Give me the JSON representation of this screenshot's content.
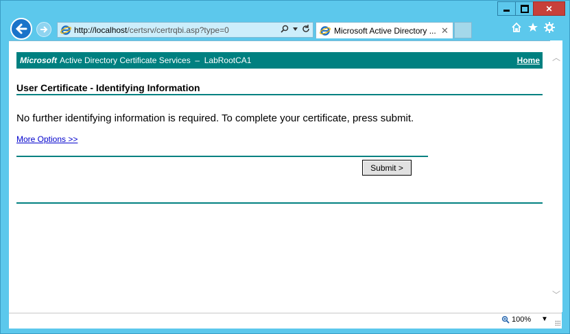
{
  "browser": {
    "address": {
      "host": "http://localhost",
      "path": "/certsrv/certrqbi.asp?type=0"
    },
    "tab": {
      "title": "Microsoft Active Directory ...",
      "close": "✕"
    },
    "window_controls": {
      "close": "✕"
    },
    "icons": [
      "back-arrow-icon",
      "forward-arrow-icon",
      "ie-logo-icon",
      "search-icon",
      "refresh-icon",
      "home-icon",
      "favorites-star-icon",
      "settings-gear-icon"
    ]
  },
  "page": {
    "banner": {
      "brand": "Microsoft",
      "title": "Active Directory Certificate Services  –  LabRootCA1",
      "home": "Home"
    },
    "heading": "User Certificate - Identifying Information",
    "message": "No further identifying information is required. To complete your certificate, press submit.",
    "more_options": "More Options >>",
    "submit_label": "Submit >"
  },
  "status": {
    "zoom": "100%"
  },
  "colors": {
    "accent": "#008080",
    "chrome": "#5cc8ec",
    "link": "#0000cc"
  }
}
